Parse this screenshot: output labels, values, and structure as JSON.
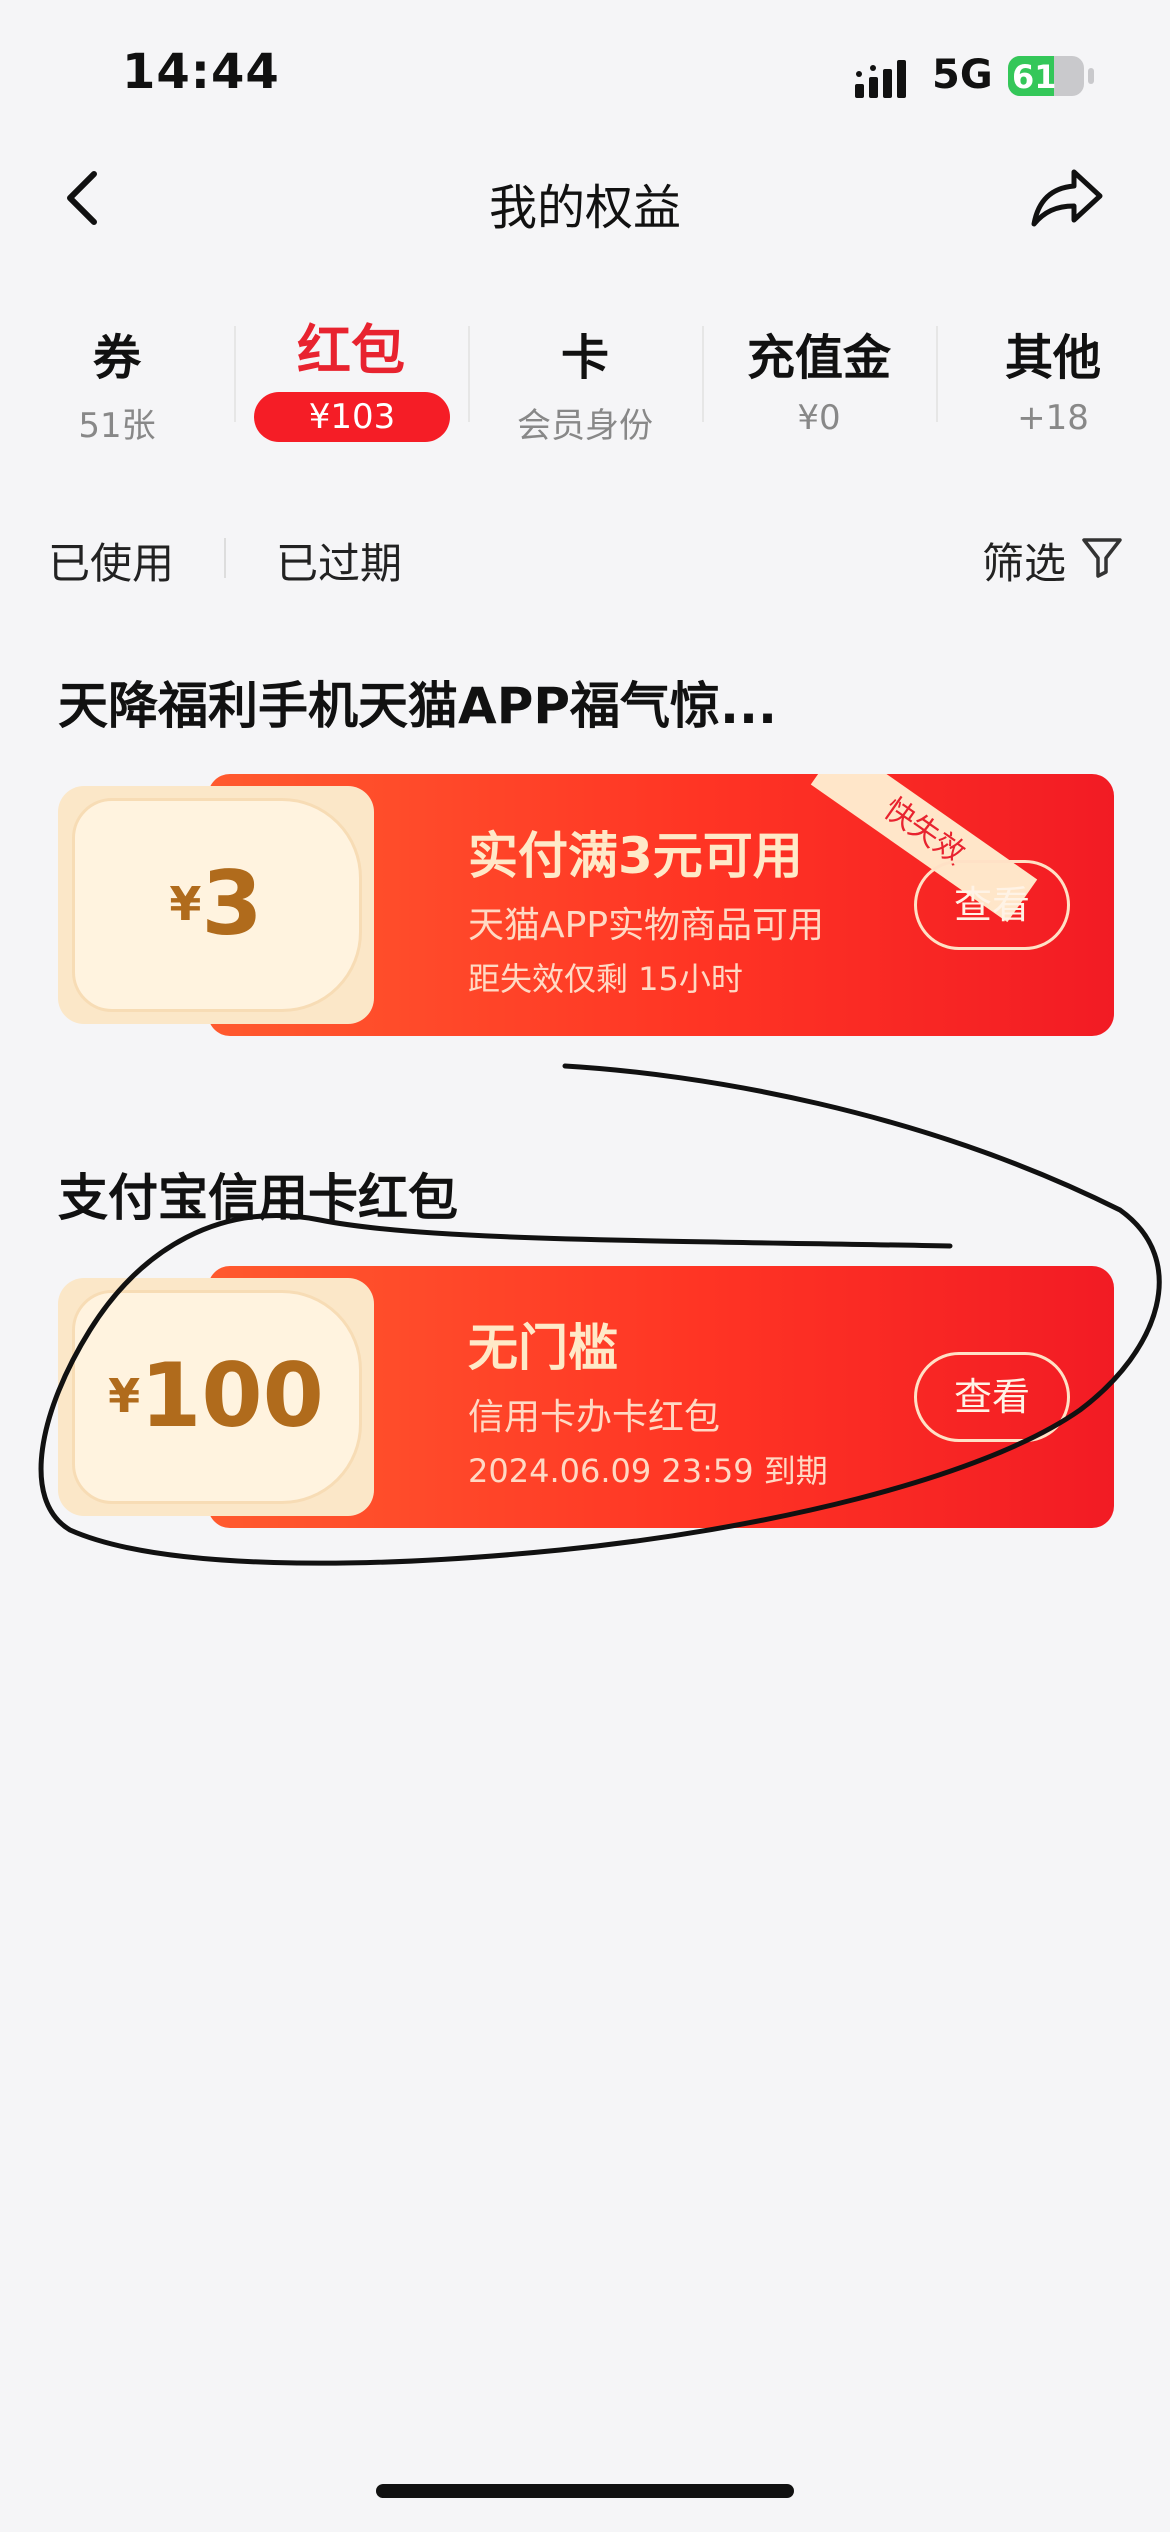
{
  "status_bar": {
    "time": "14:44",
    "network": "5G",
    "battery": "61",
    "battery_level": 0.61
  },
  "nav": {
    "title": "我的权益"
  },
  "tabs": [
    {
      "title": "券",
      "sub": "51张"
    },
    {
      "title": "红包",
      "sub": "¥103"
    },
    {
      "title": "卡",
      "sub": "会员身份"
    },
    {
      "title": "充值金",
      "sub": "¥0"
    },
    {
      "title": "其他",
      "sub": "+18"
    }
  ],
  "filters": {
    "used": "已使用",
    "expired": "已过期",
    "filter": "筛选"
  },
  "sections": [
    {
      "title": "天降福利手机天猫APP福气惊...",
      "coupon": {
        "currency": "¥",
        "amount": "3",
        "condition": "实付满3元可用",
        "description": "天猫APP实物商品可用",
        "expiry": "距失效仅剩 15小时",
        "button": "查看",
        "ribbon": "快失效"
      }
    },
    {
      "title": "支付宝信用卡红包",
      "coupon": {
        "currency": "¥",
        "amount": "100",
        "condition": "无门槛",
        "description": "信用卡办卡红包",
        "expiry": "2024.06.09 23:59 到期",
        "button": "查看"
      }
    }
  ],
  "colors": {
    "accent_red": "#e8232f",
    "coupon_gold": "#b06b1c",
    "battery_green": "#34c759"
  },
  "icons": {
    "back": "chevron-left-icon",
    "share": "share-arrow-icon",
    "filter": "funnel-icon"
  }
}
